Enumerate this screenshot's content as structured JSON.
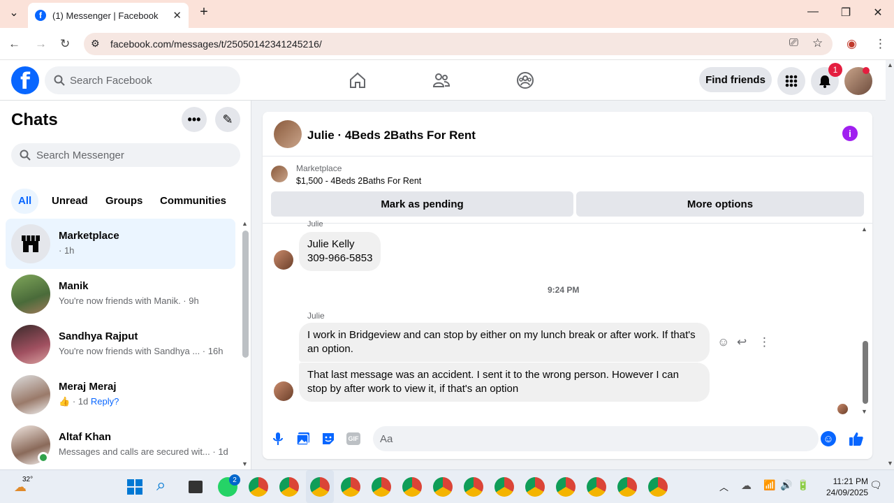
{
  "browser": {
    "tab_title": "(1) Messenger | Facebook",
    "url": "facebook.com/messages/t/25050142341245216/"
  },
  "header": {
    "search_placeholder": "Search Facebook",
    "find_friends_label": "Find friends",
    "notification_count": "1"
  },
  "sidebar": {
    "title": "Chats",
    "search_placeholder": "Search Messenger",
    "filters": [
      "All",
      "Unread",
      "Groups",
      "Communities"
    ],
    "chats": [
      {
        "name": "Marketplace",
        "subtitle": "· 1h",
        "active": true
      },
      {
        "name": "Manik",
        "subtitle": "You're now friends with Manik. · 9h"
      },
      {
        "name": "Sandhya Rajput",
        "subtitle": "You're now friends with Sandhya ... · 16h"
      },
      {
        "name": "Meraj Meraj",
        "subtitle_prefix": "· 1d",
        "subtitle_link": "Reply?"
      },
      {
        "name": "Altaf Khan",
        "subtitle": "Messages and calls are secured wit... · 1d"
      }
    ]
  },
  "conversation": {
    "title": "Julie · 4Beds 2Baths For Rent",
    "marketplace_label": "Marketplace",
    "listing": "$1,500 - 4Beds 2Baths For Rent",
    "mark_pending_label": "Mark as pending",
    "more_options_label": "More options",
    "sender_top": "Julie",
    "msg1_line1": "Julie Kelly",
    "msg1_line2": "309-966-5853",
    "timestamp": "9:24 PM",
    "sender": "Julie",
    "msg2": "I work in Bridgeview and can stop by either on my lunch break or after work. If that's an option.",
    "msg3": "That last message was an accident. I sent it to the wrong person. However I can stop by after work to view it, if that's an option",
    "composer_placeholder": "Aa"
  },
  "taskbar": {
    "weather": "32°",
    "time": "11:21 PM",
    "date": "24/09/2025",
    "whatsapp_badge": "2"
  },
  "colors": {
    "fb_blue": "#0866ff",
    "active_chat_bg": "#ebf5ff",
    "tab_bar_bg": "#fbe2d9"
  }
}
